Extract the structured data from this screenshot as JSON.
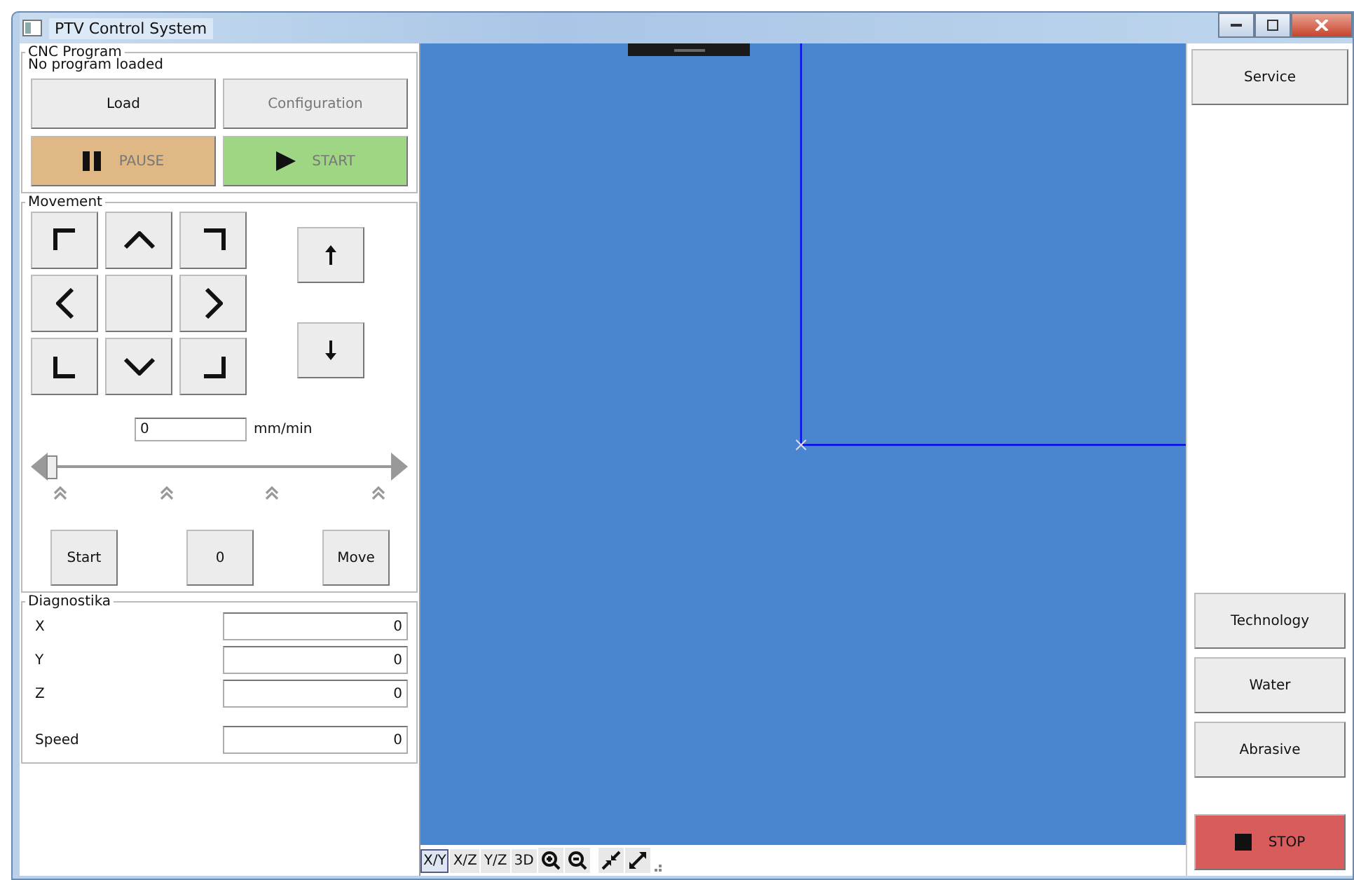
{
  "window": {
    "title": "PTV Control System"
  },
  "cnc_program": {
    "legend": "CNC Program",
    "status": "No program loaded",
    "buttons": [
      {
        "label": "Load",
        "kind": "plain",
        "disabled": false
      },
      {
        "label": "Configuration",
        "kind": "plain",
        "disabled": true
      },
      {
        "label": "PAUSE",
        "kind": "pause",
        "disabled": true
      },
      {
        "label": "START",
        "kind": "start",
        "disabled": true
      }
    ]
  },
  "movement": {
    "legend": "Movement",
    "jog": [
      {
        "kind": "corner-tl"
      },
      {
        "kind": "up"
      },
      {
        "kind": "corner-tr"
      },
      {
        "kind": "left"
      },
      {
        "kind": "none"
      },
      {
        "kind": "right"
      },
      {
        "kind": "corner-bl"
      },
      {
        "kind": "down"
      },
      {
        "kind": "corner-br"
      }
    ],
    "z_buttons": [
      {
        "kind": "up"
      },
      {
        "kind": "down"
      }
    ],
    "speed": {
      "value": "0",
      "unit": "mm/min"
    },
    "slider": {
      "level": 0
    },
    "buttons": [
      "Start",
      "0",
      "Move"
    ]
  },
  "diagnostics": {
    "legend": "Diagnostika",
    "rows": [
      {
        "label": "X",
        "value": "0"
      },
      {
        "label": "Y",
        "value": "0"
      },
      {
        "label": "Z",
        "value": "0"
      },
      {
        "label": "Speed",
        "value": "0"
      }
    ]
  },
  "view_toolbar": {
    "views": [
      {
        "label": "X/Y",
        "selected": true
      },
      {
        "label": "X/Z",
        "selected": false
      },
      {
        "label": "Y/Z",
        "selected": false
      },
      {
        "label": "3D",
        "selected": false
      }
    ]
  },
  "right_panel": {
    "top_buttons": [
      {
        "label": "Service"
      }
    ],
    "bottom_buttons": [
      {
        "label": "Technology",
        "kind": "plain"
      },
      {
        "label": "Water",
        "kind": "plain"
      },
      {
        "label": "Abrasive",
        "kind": "plain"
      },
      {
        "label": "STOP",
        "kind": "stop"
      }
    ]
  }
}
